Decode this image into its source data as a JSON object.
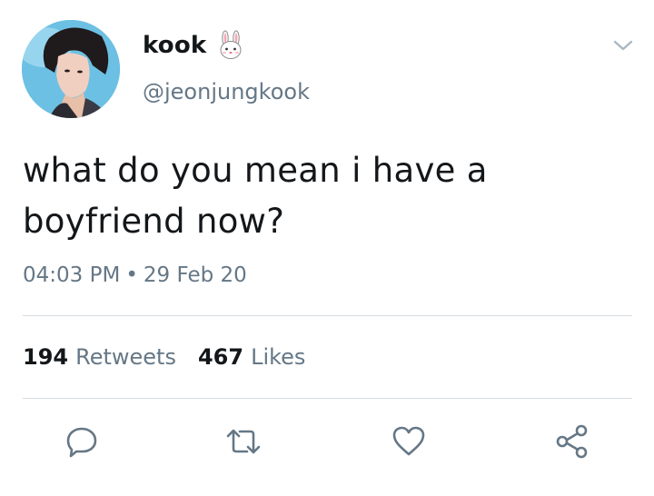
{
  "user": {
    "display_name": "kook",
    "name_emoji": "rabbit-face-icon",
    "handle": "@jeonjungkook"
  },
  "tweet": {
    "text_line1": "what do you mean i have a",
    "text_line2": "boyfriend now?",
    "time": "04:03 PM",
    "separator": "•",
    "date": "29 Feb 20"
  },
  "stats": {
    "retweets_count": "194",
    "retweets_label": "Retweets",
    "likes_count": "467",
    "likes_label": "Likes"
  },
  "actions": {
    "reply_icon": "reply-icon",
    "retweet_icon": "retweet-icon",
    "like_icon": "heart-icon",
    "share_icon": "share-icon"
  },
  "colors": {
    "primary_text": "#14171a",
    "secondary_text": "#657786",
    "divider": "#d5dce1",
    "background": "#ffffff"
  }
}
